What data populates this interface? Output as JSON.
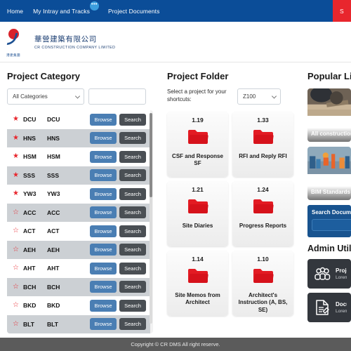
{
  "nav": {
    "items": [
      {
        "label": "Home",
        "badge": null
      },
      {
        "label": "My Intray and Tracks",
        "badge": "•••"
      },
      {
        "label": "Project Documents",
        "badge": null
      }
    ],
    "right_button": "S"
  },
  "brand": {
    "chinese_name": "華營建築有限公司",
    "english_name": "CR CONSTRUCTION COMPANY LIMITED",
    "mark_subtext": "港建集團"
  },
  "project_category": {
    "title": "Project Category",
    "category_select": "All Categories",
    "search_input_value": "",
    "search_input_placeholder": "",
    "columns": [
      "star",
      "code",
      "name",
      "browse",
      "search"
    ],
    "browse_label": "Browse",
    "search_label": "Search",
    "rows": [
      {
        "code": "DCU",
        "name": "DCU",
        "starred": true
      },
      {
        "code": "HNS",
        "name": "HNS",
        "starred": true
      },
      {
        "code": "HSM",
        "name": "HSM",
        "starred": true
      },
      {
        "code": "SSS",
        "name": "SSS",
        "starred": true
      },
      {
        "code": "YW3",
        "name": "YW3",
        "starred": true
      },
      {
        "code": "ACC",
        "name": "ACC",
        "starred": false
      },
      {
        "code": "ACT",
        "name": "ACT",
        "starred": false
      },
      {
        "code": "AEH",
        "name": "AEH",
        "starred": false
      },
      {
        "code": "AHT",
        "name": "AHT",
        "starred": false
      },
      {
        "code": "BCH",
        "name": "BCH",
        "starred": false
      },
      {
        "code": "BKD",
        "name": "BKD",
        "starred": false
      },
      {
        "code": "BLT",
        "name": "BLT",
        "starred": false
      }
    ]
  },
  "project_folder": {
    "title": "Project Folder",
    "select_prompt": "Select a project for your shortcuts:",
    "project_select": "Z100",
    "folders": [
      {
        "num": "1.19",
        "label": "CSF and Response SF"
      },
      {
        "num": "1.33",
        "label": "RFI and Reply RFI"
      },
      {
        "num": "1.21",
        "label": "Site Diaries"
      },
      {
        "num": "1.24",
        "label": "Progress Reports"
      },
      {
        "num": "1.14",
        "label": "Site Memos from Architect"
      },
      {
        "num": "1.10",
        "label": "Architect's Instruction (A, BS, SE)"
      }
    ]
  },
  "popular_links": {
    "title": "Popular Links",
    "cards": [
      {
        "caption": "All construction standards",
        "image": "construction-drawing-photo"
      },
      {
        "caption": "BIM Standards",
        "image": "bim-model-photo"
      }
    ],
    "search_panel": {
      "title": "Search Documents",
      "input_value": "",
      "input_placeholder": ""
    }
  },
  "admin_utilities": {
    "title": "Admin Utilities",
    "cards": [
      {
        "icon": "people-group-icon",
        "title": "Project",
        "subtitle": "Lorem"
      },
      {
        "icon": "document-edit-icon",
        "title": "Document",
        "subtitle": "Lorem"
      }
    ]
  },
  "footer": {
    "copyright": "Copyright © CR DMS All right reserve."
  },
  "colors": {
    "nav_blue": "#0b4d98",
    "accent_red": "#e8262d",
    "browse_blue": "#4a7eb3",
    "search_gray": "#4a4f54",
    "panel_blue": "#18538f",
    "admin_dark": "#33373d"
  }
}
